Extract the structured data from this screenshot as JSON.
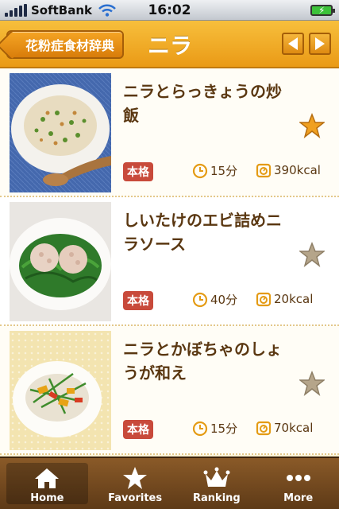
{
  "status_bar": {
    "carrier": "SoftBank",
    "time": "16:02"
  },
  "nav": {
    "back_label": "花粉症食材辞典",
    "title": "ニラ",
    "prev_icon": "left-arrow-icon",
    "next_icon": "right-arrow-icon"
  },
  "recipes": [
    {
      "title": "ニラとらっきょうの炒飯",
      "badge": "本格",
      "time": "15分",
      "kcal": "390kcal",
      "favorite": true
    },
    {
      "title": "しいたけのエビ詰めニラソース",
      "badge": "本格",
      "time": "40分",
      "kcal": "20kcal",
      "favorite": false
    },
    {
      "title": "ニラとかぼちゃのしょうが和え",
      "badge": "本格",
      "time": "15分",
      "kcal": "70kcal",
      "favorite": false
    }
  ],
  "tabs": [
    {
      "label": "Home",
      "icon": "home-icon",
      "active": true
    },
    {
      "label": "Favorites",
      "icon": "star-icon",
      "active": false
    },
    {
      "label": "Ranking",
      "icon": "crown-icon",
      "active": false
    },
    {
      "label": "More",
      "icon": "more-dots-icon",
      "active": false
    }
  ],
  "colors": {
    "nav": "#ea9a16",
    "title_text": "#5a3711",
    "badge": "#c84a3b",
    "star_active": "#f0a020",
    "star_inactive": "#b5a58a",
    "tab_bar": "#6e4520"
  }
}
